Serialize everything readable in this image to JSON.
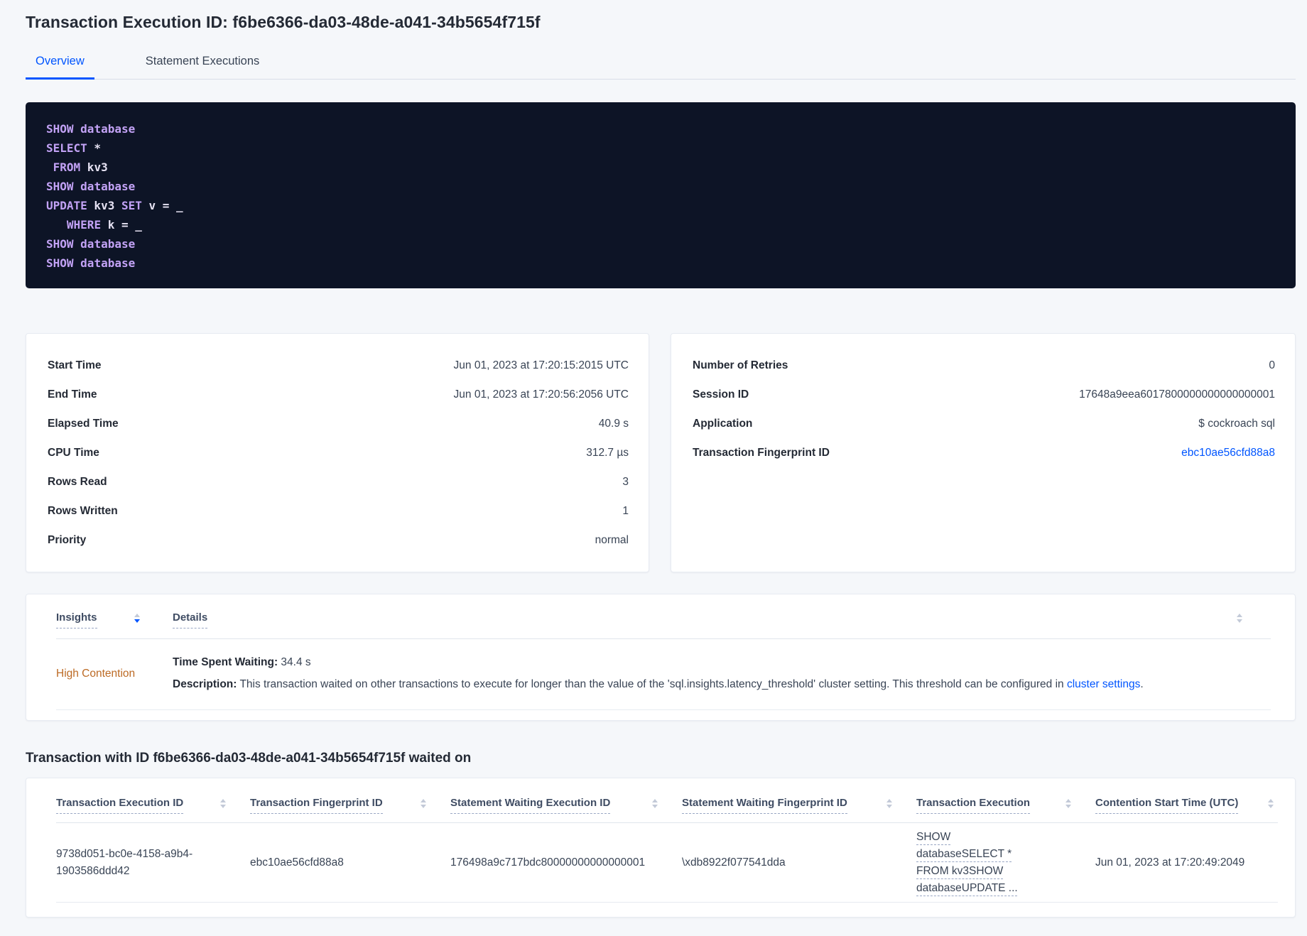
{
  "header": {
    "title": "Transaction Execution ID: f6be6366-da03-48de-a041-34b5654f715f"
  },
  "tabs": {
    "overview": "Overview",
    "statement_executions": "Statement Executions"
  },
  "colors": {
    "accent_blue": "#0055ff",
    "insight_orange": "#bc6a24",
    "code_background": "#0d1426",
    "code_keyword": "#c2a2f5",
    "code_plain": "#e6e2f3"
  },
  "sql_block": {
    "lines": [
      {
        "tokens": [
          {
            "c": "kw",
            "t": "SHOW"
          },
          {
            "c": "pl",
            "t": " "
          },
          {
            "c": "kw",
            "t": "database"
          }
        ]
      },
      {
        "tokens": [
          {
            "c": "kw",
            "t": "SELECT"
          },
          {
            "c": "pl",
            "t": " *"
          }
        ]
      },
      {
        "tokens": [
          {
            "c": "pl",
            "t": " "
          },
          {
            "c": "kw",
            "t": "FROM"
          },
          {
            "c": "pl",
            "t": " kv3"
          }
        ]
      },
      {
        "tokens": [
          {
            "c": "kw",
            "t": "SHOW"
          },
          {
            "c": "pl",
            "t": " "
          },
          {
            "c": "kw",
            "t": "database"
          }
        ]
      },
      {
        "tokens": [
          {
            "c": "kw",
            "t": "UPDATE"
          },
          {
            "c": "pl",
            "t": " kv3 "
          },
          {
            "c": "kw",
            "t": "SET"
          },
          {
            "c": "pl",
            "t": " v = _"
          }
        ]
      },
      {
        "tokens": [
          {
            "c": "pl",
            "t": "   "
          },
          {
            "c": "kw",
            "t": "WHERE"
          },
          {
            "c": "pl",
            "t": " k = _"
          }
        ]
      },
      {
        "tokens": [
          {
            "c": "kw",
            "t": "SHOW"
          },
          {
            "c": "pl",
            "t": " "
          },
          {
            "c": "kw",
            "t": "database"
          }
        ]
      },
      {
        "tokens": [
          {
            "c": "kw",
            "t": "SHOW"
          },
          {
            "c": "pl",
            "t": " "
          },
          {
            "c": "kw",
            "t": "database"
          }
        ]
      }
    ]
  },
  "left_card": {
    "rows": [
      {
        "label": "Start Time",
        "value": "Jun 01, 2023 at 17:20:15:2015 UTC"
      },
      {
        "label": "End Time",
        "value": "Jun 01, 2023 at 17:20:56:2056 UTC"
      },
      {
        "label": "Elapsed Time",
        "value": "40.9 s"
      },
      {
        "label": "CPU Time",
        "value": "312.7 µs"
      },
      {
        "label": "Rows Read",
        "value": "3"
      },
      {
        "label": "Rows Written",
        "value": "1"
      },
      {
        "label": "Priority",
        "value": "normal"
      }
    ]
  },
  "right_card": {
    "rows": [
      {
        "label": "Number of Retries",
        "value": "0"
      },
      {
        "label": "Session ID",
        "value": "17648a9eea6017800000000000000001"
      },
      {
        "label": "Application",
        "value": "$ cockroach sql"
      }
    ],
    "fingerprint": {
      "label": "Transaction Fingerprint ID",
      "value": "ebc10ae56cfd88a8"
    }
  },
  "insights": {
    "col_insights": "Insights",
    "col_details": "Details",
    "row": {
      "insight": "High Contention",
      "waiting_label": "Time Spent Waiting:",
      "waiting_value": " 34.4 s",
      "desc_label": "Description:",
      "desc_text": " This transaction waited on other transactions to execute for longer than the value of the 'sql.insights.latency_threshold' cluster setting. This threshold can be configured in ",
      "desc_link": "cluster settings",
      "desc_suffix": "."
    }
  },
  "waited_on": {
    "title": "Transaction with ID f6be6366-da03-48de-a041-34b5654f715f waited on",
    "columns": [
      "Transaction Execution ID",
      "Transaction Fingerprint ID",
      "Statement Waiting Execution ID",
      "Statement Waiting Fingerprint ID",
      "Transaction Execution",
      "Contention Start Time (UTC)"
    ],
    "row": {
      "txn_execution_id": "9738d051-bc0e-4158-a9b4-1903586ddd42",
      "txn_fingerprint_id": "ebc10ae56cfd88a8",
      "stmt_waiting_execution_id": "176498a9c717bdc80000000000000001",
      "stmt_waiting_fingerprint_id": "\\xdb8922f077541dda",
      "txn_execution": "SHOW databaseSELECT * FROM kv3SHOW databaseUPDATE ...",
      "contention_start": "Jun 01, 2023 at 17:20:49:2049"
    }
  }
}
